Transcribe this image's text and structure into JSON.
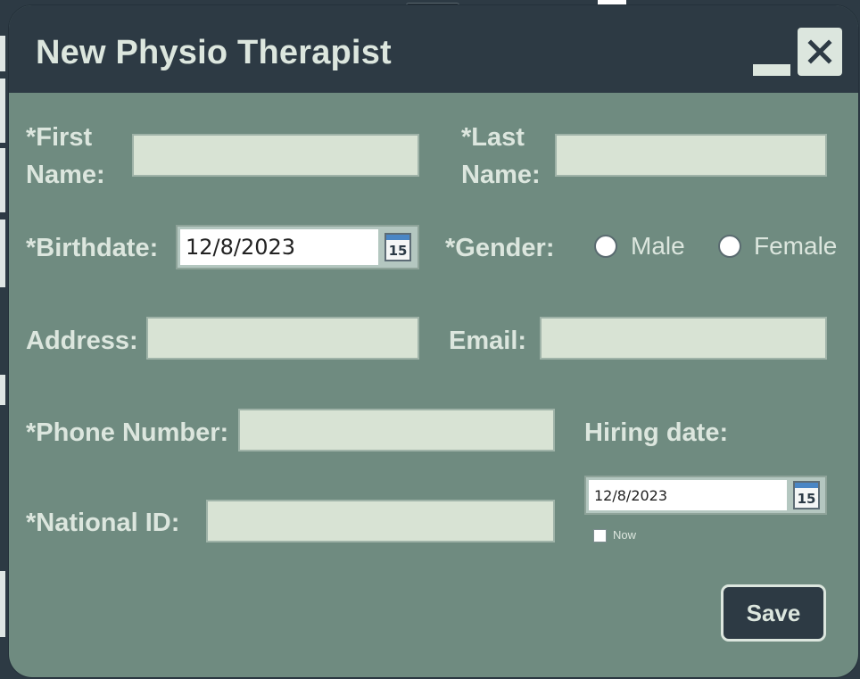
{
  "window": {
    "title": "New Physio Therapist",
    "close_icon": "close-icon",
    "minimize_icon": "minimize-icon"
  },
  "form": {
    "first_name": {
      "label_line1": "*First",
      "label_line2": "Name:",
      "value": ""
    },
    "last_name": {
      "label_line1": "*Last",
      "label_line2": "Name:",
      "value": ""
    },
    "birthdate": {
      "label": "*Birthdate:",
      "value": "12/8/2023",
      "calendar_day": "15"
    },
    "gender": {
      "label": "*Gender:",
      "options": [
        "Male",
        "Female"
      ],
      "selected": null
    },
    "address": {
      "label": "Address:",
      "value": ""
    },
    "email": {
      "label": "Email:",
      "value": ""
    },
    "phone": {
      "label": "*Phone Number:",
      "value": ""
    },
    "hiring_date": {
      "label": "Hiring date:",
      "value": "12/8/2023",
      "calendar_day": "15",
      "now_label": "Now",
      "now_checked": false
    },
    "national_id": {
      "label": "*National ID:",
      "value": ""
    }
  },
  "actions": {
    "save_label": "Save"
  },
  "colors": {
    "titlebar": "#2d3a44",
    "body": "#6f8b80",
    "field": "#d8e3d4",
    "text": "#dce6de"
  }
}
